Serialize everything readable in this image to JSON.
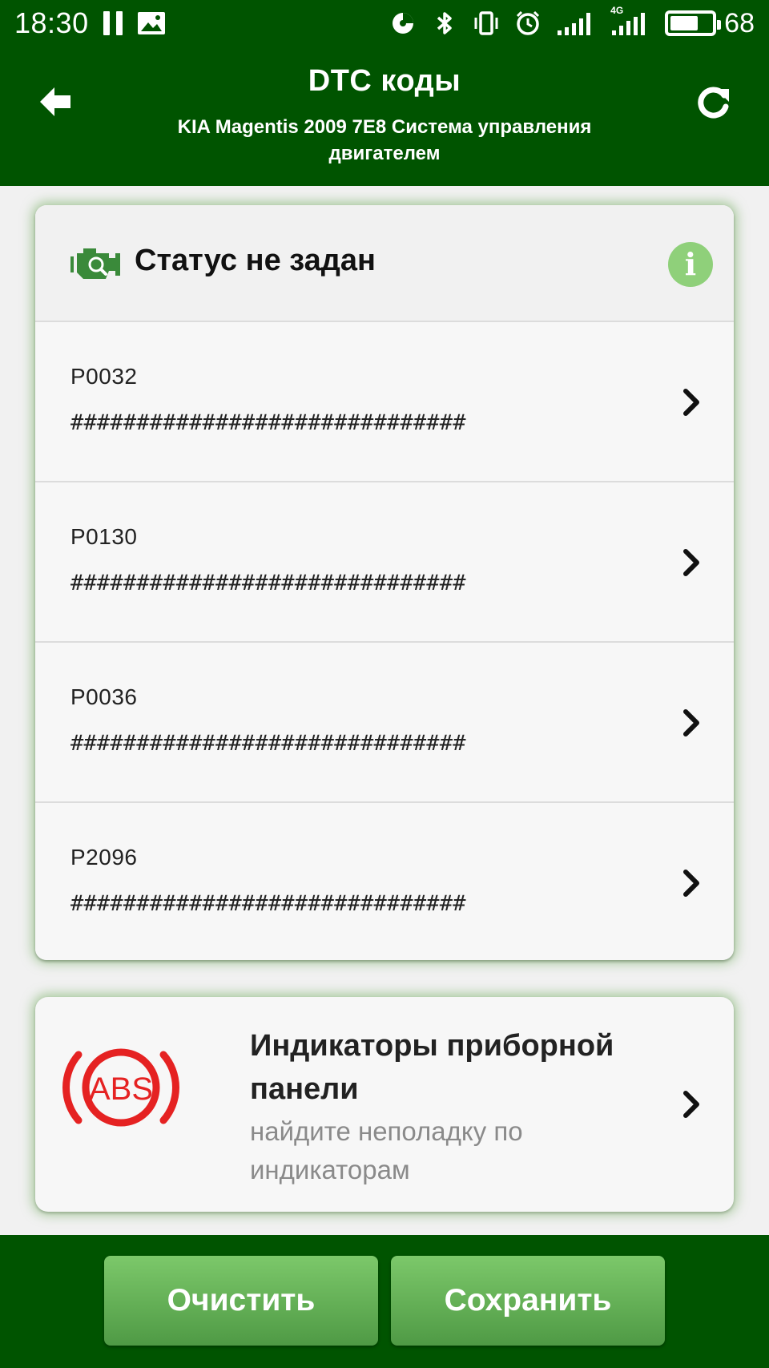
{
  "status_bar": {
    "time": "18:30",
    "battery_level": "68",
    "network": "4G"
  },
  "header": {
    "title": "DTC коды",
    "subtitle": "KIA Magentis 2009 7E8 Система управления двигателем"
  },
  "dtc_card": {
    "status": "Статус не задан",
    "info_icon_glyph": "i",
    "codes": [
      {
        "code": "P0032",
        "description": "##############################"
      },
      {
        "code": "P0130",
        "description": "##############################"
      },
      {
        "code": "P0036",
        "description": "##############################"
      },
      {
        "code": "P2096",
        "description": "##############################"
      }
    ]
  },
  "indicators_card": {
    "title": "Индикаторы приборной панели",
    "subtitle": "найдите неполадку по индикаторам",
    "icon_text": "ABS"
  },
  "actions": {
    "clear_label": "Очистить",
    "save_label": "Сохранить"
  },
  "colors": {
    "header_bg": "#005400",
    "button_green": "#6bb85c",
    "info_green": "#8fd07a",
    "abs_red": "#e52222"
  }
}
